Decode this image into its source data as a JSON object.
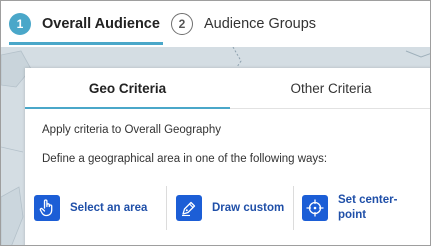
{
  "steps": [
    {
      "number": "1",
      "label": "Overall Audience",
      "active": true
    },
    {
      "number": "2",
      "label": "Audience Groups",
      "active": false
    }
  ],
  "panel": {
    "tabs": [
      {
        "label": "Geo Criteria",
        "active": true
      },
      {
        "label": "Other Criteria",
        "active": false
      }
    ],
    "info_line_1": "Apply criteria to Overall Geography",
    "info_line_2": "Define a geographical area in one of the following ways:",
    "options": [
      {
        "label": "Select an area",
        "icon": "hand-pointer-icon"
      },
      {
        "label": "Draw custom",
        "icon": "pen-icon"
      },
      {
        "label": "Set center-point",
        "icon": "crosshair-icon"
      }
    ]
  },
  "colors": {
    "accent": "#4aa7c9",
    "option_icon_bg": "#1c5ed6",
    "option_label": "#1f4fa8",
    "map_bg": "#d4dde3"
  }
}
